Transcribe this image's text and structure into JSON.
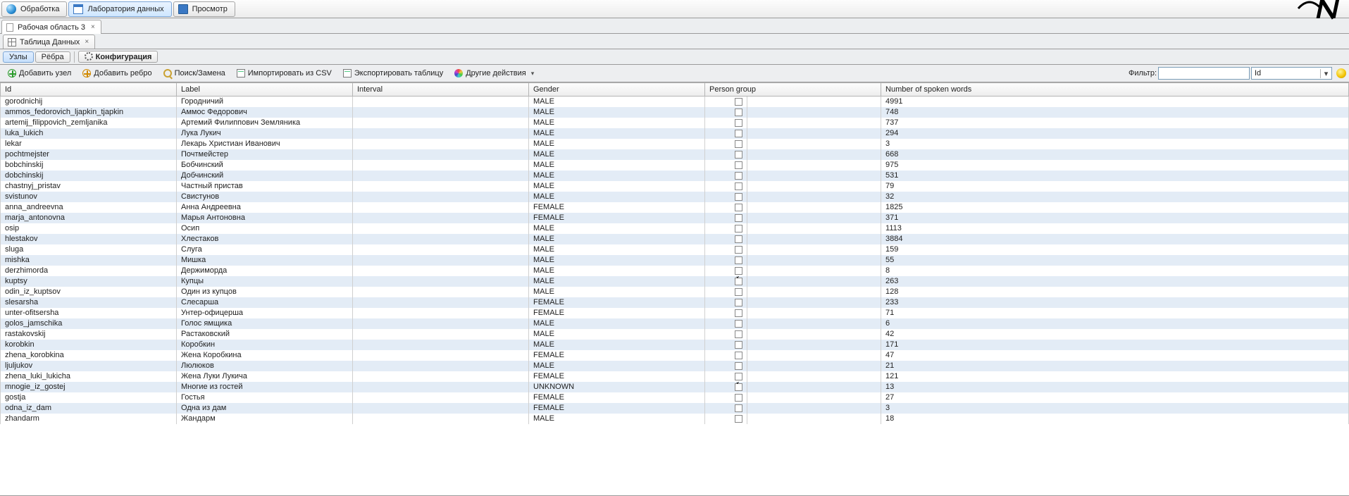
{
  "topTabs": [
    {
      "label": "Обработка",
      "icon": "globe"
    },
    {
      "label": "Лаборатория данных",
      "icon": "win",
      "active": true
    },
    {
      "label": "Просмотр",
      "icon": "monitor"
    }
  ],
  "logo": "",
  "workspaceTab": "Рабочая область 3",
  "innerTab": "Таблица Данных",
  "toggles": {
    "nodes": "Узлы",
    "edges": "Рёбра",
    "config": "Конфигурация"
  },
  "toolbar": {
    "add_node": "Добавить узел",
    "add_edge": "Добавить ребро",
    "search": "Поиск/Замена",
    "import": "Импортировать из CSV",
    "export": "Экспортировать таблицу",
    "other": "Другие действия",
    "filter_label": "Фильтр:",
    "filter_value": "",
    "filter_by": "Id"
  },
  "columns": [
    "Id",
    "Label",
    "Interval",
    "Gender",
    "Person group",
    "Number of spoken words"
  ],
  "rows": [
    {
      "id": "gorodnichij",
      "label": "Городничий",
      "interval": "",
      "gender": "MALE",
      "pg": false,
      "words": 4991
    },
    {
      "id": "ammos_fedorovich_ljapkin_tjapkin",
      "label": "Аммос Федорович",
      "interval": "",
      "gender": "MALE",
      "pg": false,
      "words": 748
    },
    {
      "id": "artemij_filippovich_zemljanika",
      "label": "Артемий Филиппович Земляника",
      "interval": "",
      "gender": "MALE",
      "pg": false,
      "words": 737
    },
    {
      "id": "luka_lukich",
      "label": "Лука Лукич",
      "interval": "",
      "gender": "MALE",
      "pg": false,
      "words": 294
    },
    {
      "id": "lekar",
      "label": "Лекарь Христиан Иванович",
      "interval": "",
      "gender": "MALE",
      "pg": false,
      "words": 3
    },
    {
      "id": "pochtmejster",
      "label": "Почтмейстер",
      "interval": "",
      "gender": "MALE",
      "pg": false,
      "words": 668
    },
    {
      "id": "bobchinskij",
      "label": "Бобчинский",
      "interval": "",
      "gender": "MALE",
      "pg": false,
      "words": 975
    },
    {
      "id": "dobchinskij",
      "label": "Добчинский",
      "interval": "",
      "gender": "MALE",
      "pg": false,
      "words": 531
    },
    {
      "id": "chastnyj_pristav",
      "label": "Частный пристав",
      "interval": "",
      "gender": "MALE",
      "pg": false,
      "words": 79
    },
    {
      "id": "svistunov",
      "label": "Свистунов",
      "interval": "",
      "gender": "MALE",
      "pg": false,
      "words": 32
    },
    {
      "id": "anna_andreevna",
      "label": "Анна Андреевна",
      "interval": "",
      "gender": "FEMALE",
      "pg": false,
      "words": 1825
    },
    {
      "id": "marja_antonovna",
      "label": "Марья Антоновна",
      "interval": "",
      "gender": "FEMALE",
      "pg": false,
      "words": 371
    },
    {
      "id": "osip",
      "label": "Осип",
      "interval": "",
      "gender": "MALE",
      "pg": false,
      "words": 1113
    },
    {
      "id": "hlestakov",
      "label": "Хлестаков",
      "interval": "",
      "gender": "MALE",
      "pg": false,
      "words": 3884
    },
    {
      "id": "sluga",
      "label": "Слуга",
      "interval": "",
      "gender": "MALE",
      "pg": false,
      "words": 159
    },
    {
      "id": "mishka",
      "label": "Мишка",
      "interval": "",
      "gender": "MALE",
      "pg": false,
      "words": 55
    },
    {
      "id": "derzhimorda",
      "label": "Держиморда",
      "interval": "",
      "gender": "MALE",
      "pg": false,
      "words": 8
    },
    {
      "id": "kuptsy",
      "label": "Купцы",
      "interval": "",
      "gender": "MALE",
      "pg": true,
      "words": 263
    },
    {
      "id": "odin_iz_kuptsov",
      "label": "Один из купцов",
      "interval": "",
      "gender": "MALE",
      "pg": false,
      "words": 128
    },
    {
      "id": "slesarsha",
      "label": "Слесарша",
      "interval": "",
      "gender": "FEMALE",
      "pg": false,
      "words": 233
    },
    {
      "id": "unter-ofitsersha",
      "label": "Унтер-офицерша",
      "interval": "",
      "gender": "FEMALE",
      "pg": false,
      "words": 71
    },
    {
      "id": "golos_jamschika",
      "label": "Голос ямщика",
      "interval": "",
      "gender": "MALE",
      "pg": false,
      "words": 6
    },
    {
      "id": "rastakovskij",
      "label": "Растаковский",
      "interval": "",
      "gender": "MALE",
      "pg": false,
      "words": 42
    },
    {
      "id": "korobkin",
      "label": "Коробкин",
      "interval": "",
      "gender": "MALE",
      "pg": false,
      "words": 171
    },
    {
      "id": "zhena_korobkina",
      "label": "Жена Коробкина",
      "interval": "",
      "gender": "FEMALE",
      "pg": false,
      "words": 47
    },
    {
      "id": "ljuljukov",
      "label": "Люлюков",
      "interval": "",
      "gender": "MALE",
      "pg": false,
      "words": 21
    },
    {
      "id": "zhena_luki_lukicha",
      "label": "Жена Луки Лукича",
      "interval": "",
      "gender": "FEMALE",
      "pg": false,
      "words": 121
    },
    {
      "id": "mnogie_iz_gostej",
      "label": "Многие из гостей",
      "interval": "",
      "gender": "UNKNOWN",
      "pg": true,
      "words": 13
    },
    {
      "id": "gostja",
      "label": "Гостья",
      "interval": "",
      "gender": "FEMALE",
      "pg": false,
      "words": 27
    },
    {
      "id": "odna_iz_dam",
      "label": "Одна из дам",
      "interval": "",
      "gender": "FEMALE",
      "pg": false,
      "words": 3
    },
    {
      "id": "zhandarm",
      "label": "Жандарм",
      "interval": "",
      "gender": "MALE",
      "pg": false,
      "words": 18
    }
  ]
}
